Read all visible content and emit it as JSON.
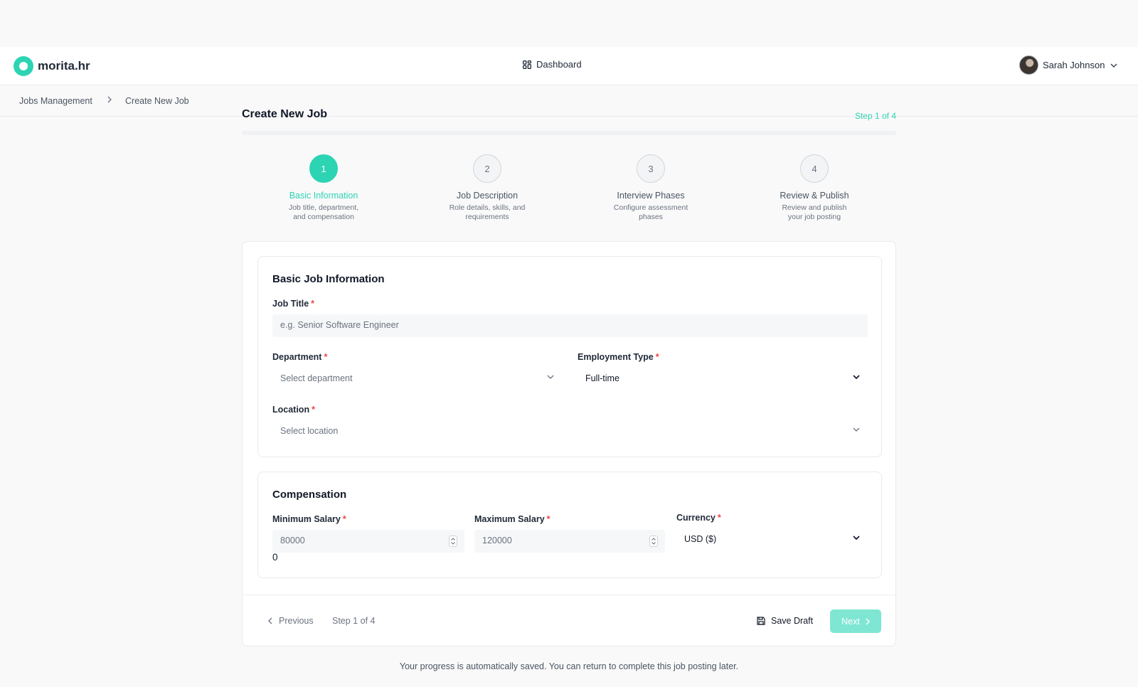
{
  "brand": {
    "name": "morita.hr"
  },
  "nav": {
    "dashboard": "Dashboard"
  },
  "user": {
    "name": "Sarah Johnson"
  },
  "breadcrumb": {
    "items": [
      "Jobs Management",
      "Create New Job"
    ]
  },
  "header": {
    "title": "Create New Job",
    "step_count": "Step 1 of 4"
  },
  "steps": [
    {
      "number": "1",
      "title": "Basic Information",
      "desc": "Job title, department, and compensation"
    },
    {
      "number": "2",
      "title": "Job Description",
      "desc": "Role details, skills, and requirements"
    },
    {
      "number": "3",
      "title": "Interview Phases",
      "desc": "Configure assessment phases"
    },
    {
      "number": "4",
      "title": "Review & Publish",
      "desc": "Review and publish your job posting"
    }
  ],
  "basic": {
    "title": "Basic Job Information",
    "job_title_label": "Job Title",
    "job_title_placeholder": "e.g. Senior Software Engineer",
    "department_label": "Department",
    "department_value": "Select department",
    "employment_label": "Employment Type",
    "employment_value": "Full-time",
    "location_label": "Location",
    "location_value": "Select location",
    "required_mark": "*"
  },
  "compensation": {
    "title": "Compensation",
    "min_label": "Minimum Salary",
    "min_value": "80000",
    "max_label": "Maximum Salary",
    "max_value": "120000",
    "currency_label": "Currency",
    "currency_value": "USD ($)",
    "stray_text": "0"
  },
  "footer": {
    "previous": "Previous",
    "step": "Step 1 of 4",
    "save_draft": "Save Draft",
    "next": "Next"
  },
  "autosave_note": "Your progress is automatically saved. You can return to complete this job posting later.",
  "colors": {
    "accent": "#2dd4b4",
    "accent_light": "#7fe6d3",
    "required": "#ef4444"
  }
}
